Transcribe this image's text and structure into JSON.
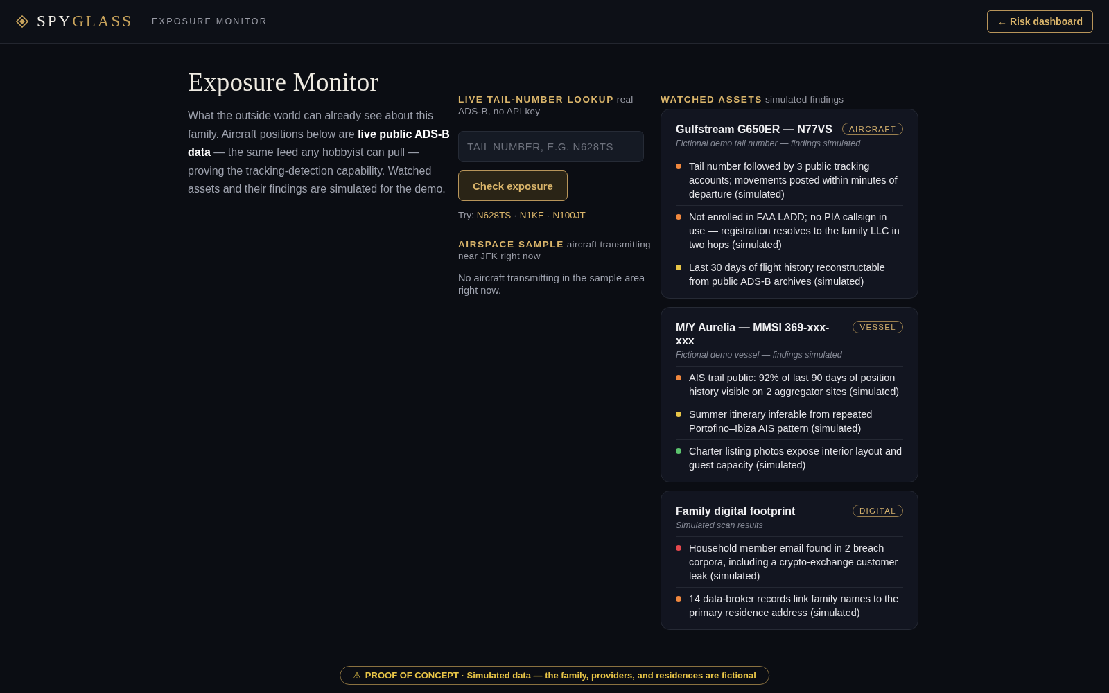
{
  "header": {
    "brand": {
      "lead": "SPY",
      "accent": "GLASS"
    },
    "section": "EXPOSURE MONITOR",
    "back_button": "← Risk dashboard"
  },
  "intro": {
    "title": "Exposure Monitor",
    "text": "What the outside world can already see about this family. Aircraft positions below are **live public ADS-B data** — the same feed any hobbyist can pull — proving the tracking-detection capability. Watched assets and their findings are simulated for the demo."
  },
  "lookup": {
    "label": "LIVE TAIL-NUMBER LOOKUP",
    "note": "real ADS-B, no API key",
    "placeholder": "TAIL NUMBER, E.G. N628TS",
    "button": "Check exposure",
    "try_label": "Try:",
    "separator": "·",
    "examples": [
      "N628TS",
      "N1KE",
      "N100JT"
    ]
  },
  "airspace": {
    "label": "AIRSPACE SAMPLE",
    "note": "aircraft transmitting near JFK right now",
    "message": "No aircraft transmitting in the sample area right now."
  },
  "watched": {
    "label": "WATCHED ASSETS",
    "note": "simulated findings",
    "cards": [
      {
        "title": "Gulfstream G650ER — N77VS",
        "tag": "AIRCRAFT",
        "subtitle": "Fictional demo tail number — findings simulated",
        "findings": [
          {
            "text": "Tail number followed by 3 public tracking accounts; movements posted within minutes of departure (simulated)",
            "color": "#f0883e"
          },
          {
            "text": "Not enrolled in FAA LADD; no PIA callsign in use — registration resolves to the family LLC in two hops (simulated)",
            "color": "#f0883e"
          },
          {
            "text": "Last 30 days of flight history reconstructable from public ADS-B archives (simulated)",
            "color": "#e8c547"
          }
        ]
      },
      {
        "title": "M/Y Aurelia — MMSI 369-xxx-xxx",
        "tag": "VESSEL",
        "subtitle": "Fictional demo vessel — findings simulated",
        "findings": [
          {
            "text": "AIS trail public: 92% of last 90 days of position history visible on 2 aggregator sites (simulated)",
            "color": "#f0883e"
          },
          {
            "text": "Summer itinerary inferable from repeated Portofino–Ibiza AIS pattern (simulated)",
            "color": "#e8c547"
          },
          {
            "text": "Charter listing photos expose interior layout and guest capacity (simulated)",
            "color": "#5cc46e"
          }
        ]
      },
      {
        "title": "Family digital footprint",
        "tag": "DIGITAL",
        "subtitle": "Simulated scan results",
        "findings": [
          {
            "text": "Household member email found in 2 breach corpora, including a crypto-exchange customer leak (simulated)",
            "color": "#e5484d"
          },
          {
            "text": "14 data-broker records link family names to the primary residence address (simulated)",
            "color": "#f0883e"
          }
        ]
      }
    ]
  },
  "banner": {
    "icon": "⚠",
    "text": "PROOF OF CONCEPT · Simulated data — the family, providers, and residences are fictional"
  }
}
